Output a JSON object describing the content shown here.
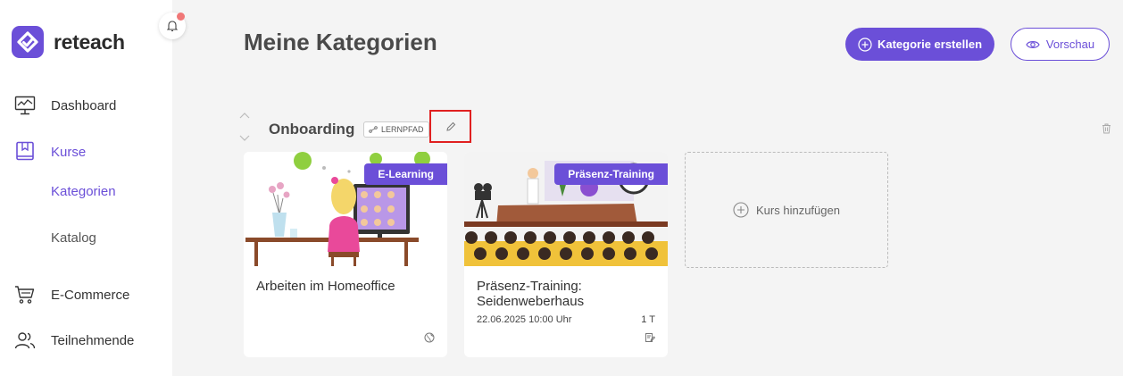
{
  "app": {
    "name": "reteach"
  },
  "sidebar": {
    "items": [
      {
        "label": "Dashboard",
        "icon": "dashboard-icon"
      },
      {
        "label": "Kurse",
        "icon": "book-icon",
        "active": true
      },
      {
        "label": "E-Commerce",
        "icon": "cart-icon"
      },
      {
        "label": "Teilnehmende",
        "icon": "users-icon"
      }
    ],
    "subitems": [
      {
        "label": "Kategorien",
        "active": true
      },
      {
        "label": "Katalog"
      }
    ]
  },
  "header": {
    "title": "Meine Kategorien",
    "create_label": "Kategorie erstellen",
    "preview_label": "Vorschau"
  },
  "category": {
    "title": "Onboarding",
    "tag": "LERNPFAD"
  },
  "courses": [
    {
      "title": "Arbeiten im Homeoffice",
      "badge": "E-Learning"
    },
    {
      "title": "Präsenz-Training: Seidenweberhaus",
      "badge": "Präsenz-Training",
      "date": "22.06.2025 10:00 Uhr",
      "duration": "1 T"
    }
  ],
  "add_course_label": "Kurs hinzufügen",
  "colors": {
    "accent": "#6b4fd8",
    "highlight": "#e02020"
  }
}
